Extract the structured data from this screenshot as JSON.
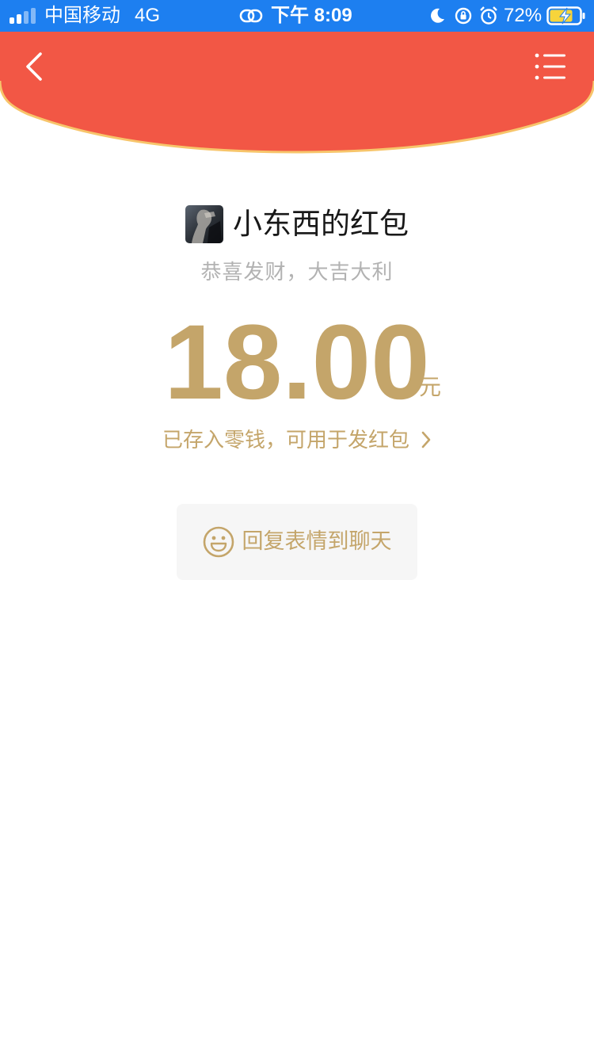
{
  "status_bar": {
    "carrier": "中国移动",
    "network": "4G",
    "time": "下午 8:09",
    "battery": "72%",
    "background_color": "#1d7ff0"
  },
  "header": {
    "color": "#f25745",
    "border_color": "#f7c56b",
    "back_icon": "chevron-left-icon",
    "menu_icon": "list-menu-icon"
  },
  "sender": {
    "title": "小东西的红包",
    "avatar": "avatar-photo"
  },
  "blessing": "恭喜发财，大吉大利",
  "amount": {
    "value": "18.00",
    "unit": "元",
    "color": "#c4a56a"
  },
  "deposit_link": {
    "label": "已存入零钱，可用于发红包"
  },
  "reply_button": {
    "label": "回复表情到聊天",
    "icon": "smiley-icon"
  }
}
